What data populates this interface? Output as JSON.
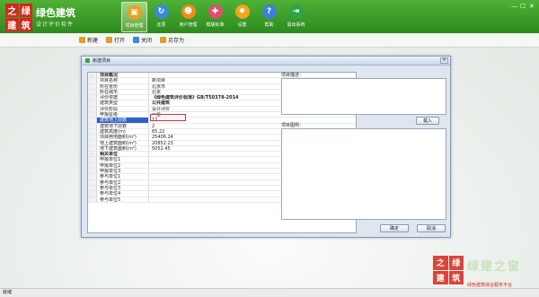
{
  "app": {
    "logo_chars": [
      "之",
      "绿",
      "建",
      "筑"
    ],
    "name": "绿色建筑",
    "subtitle": "设计评价软件"
  },
  "nav": [
    {
      "label": "项目管理",
      "icon": "folder-icon",
      "color": "#e8a21b",
      "glyph": "▣"
    },
    {
      "label": "还原",
      "icon": "refresh-icon",
      "color": "#3b8ad9",
      "glyph": "↻"
    },
    {
      "label": "用户管理",
      "icon": "users-icon",
      "color": "#f08a1b",
      "glyph": "☻"
    },
    {
      "label": "模版标准",
      "icon": "template-icon",
      "color": "#e04e6a",
      "glyph": "✚"
    },
    {
      "label": "设置",
      "icon": "gear-icon",
      "color": "#f0a51b",
      "glyph": "✹"
    },
    {
      "label": "帮助",
      "icon": "help-icon",
      "color": "#3b7fd9",
      "glyph": "?"
    },
    {
      "label": "退出系统",
      "icon": "exit-icon",
      "color": "#2fa34a",
      "glyph": "⇥"
    }
  ],
  "toolbar": [
    {
      "label": "新建",
      "icon": "new-icon",
      "color": "#e0a020"
    },
    {
      "label": "打开",
      "icon": "open-icon",
      "color": "#d9a030"
    },
    {
      "label": "关闭",
      "icon": "close-icon",
      "color": "#3b8ad9"
    },
    {
      "label": "另存为",
      "icon": "save-as-icon",
      "color": "#e0a020"
    }
  ],
  "dialog": {
    "title": "新建项目",
    "close": "×",
    "desc_label": "项目描述：",
    "image_label": "项目图例：",
    "import": "载入",
    "ok": "确定",
    "cancel": "取消"
  },
  "rows": [
    {
      "g": "-",
      "k": "项目概况",
      "v": "",
      "section": true
    },
    {
      "g": "",
      "k": "项目名称",
      "v": "新项目"
    },
    {
      "g": "",
      "k": "所在省份",
      "v": "北京市"
    },
    {
      "g": "",
      "k": "所在城市",
      "v": "北京"
    },
    {
      "g": "",
      "k": "评价依据",
      "v": "《绿色建筑评价标准》GB/T50378-2014"
    },
    {
      "g": "",
      "k": "建筑类型",
      "v": "公共建筑"
    },
    {
      "g": "",
      "k": "评价阶段",
      "v": "设计评价"
    },
    {
      "g": "",
      "k": "申报星级",
      "v": "一星"
    },
    {
      "g": "",
      "k": "建筑地上层数",
      "v": "12",
      "sel": true
    },
    {
      "g": "",
      "k": "建筑地下层数",
      "v": "2"
    },
    {
      "g": "",
      "k": "建筑高度(m)",
      "v": "65.22"
    },
    {
      "g": "",
      "k": "项目用地面积(m²)",
      "v": "25406.24"
    },
    {
      "g": "",
      "k": "地上建筑面积(m²)",
      "v": "20852.23"
    },
    {
      "g": "",
      "k": "地下建筑面积(m²)",
      "v": "5052.45"
    },
    {
      "g": "-",
      "k": "相关单位",
      "v": "",
      "section": true
    },
    {
      "g": "",
      "k": "申报单位1",
      "v": ""
    },
    {
      "g": "",
      "k": "申报单位2",
      "v": ""
    },
    {
      "g": "",
      "k": "申报单位3",
      "v": ""
    },
    {
      "g": "",
      "k": "参与单位1",
      "v": ""
    },
    {
      "g": "",
      "k": "参与单位2",
      "v": ""
    },
    {
      "g": "",
      "k": "参与单位3",
      "v": ""
    },
    {
      "g": "",
      "k": "参与单位4",
      "v": ""
    },
    {
      "g": "",
      "k": "参与单位5",
      "v": ""
    }
  ],
  "watermark": {
    "logo_chars": [
      "之",
      "绿",
      "建",
      "筑"
    ],
    "big": "绿建之窗",
    "small": "绿色建筑综合服务平台"
  },
  "status": "就绪"
}
